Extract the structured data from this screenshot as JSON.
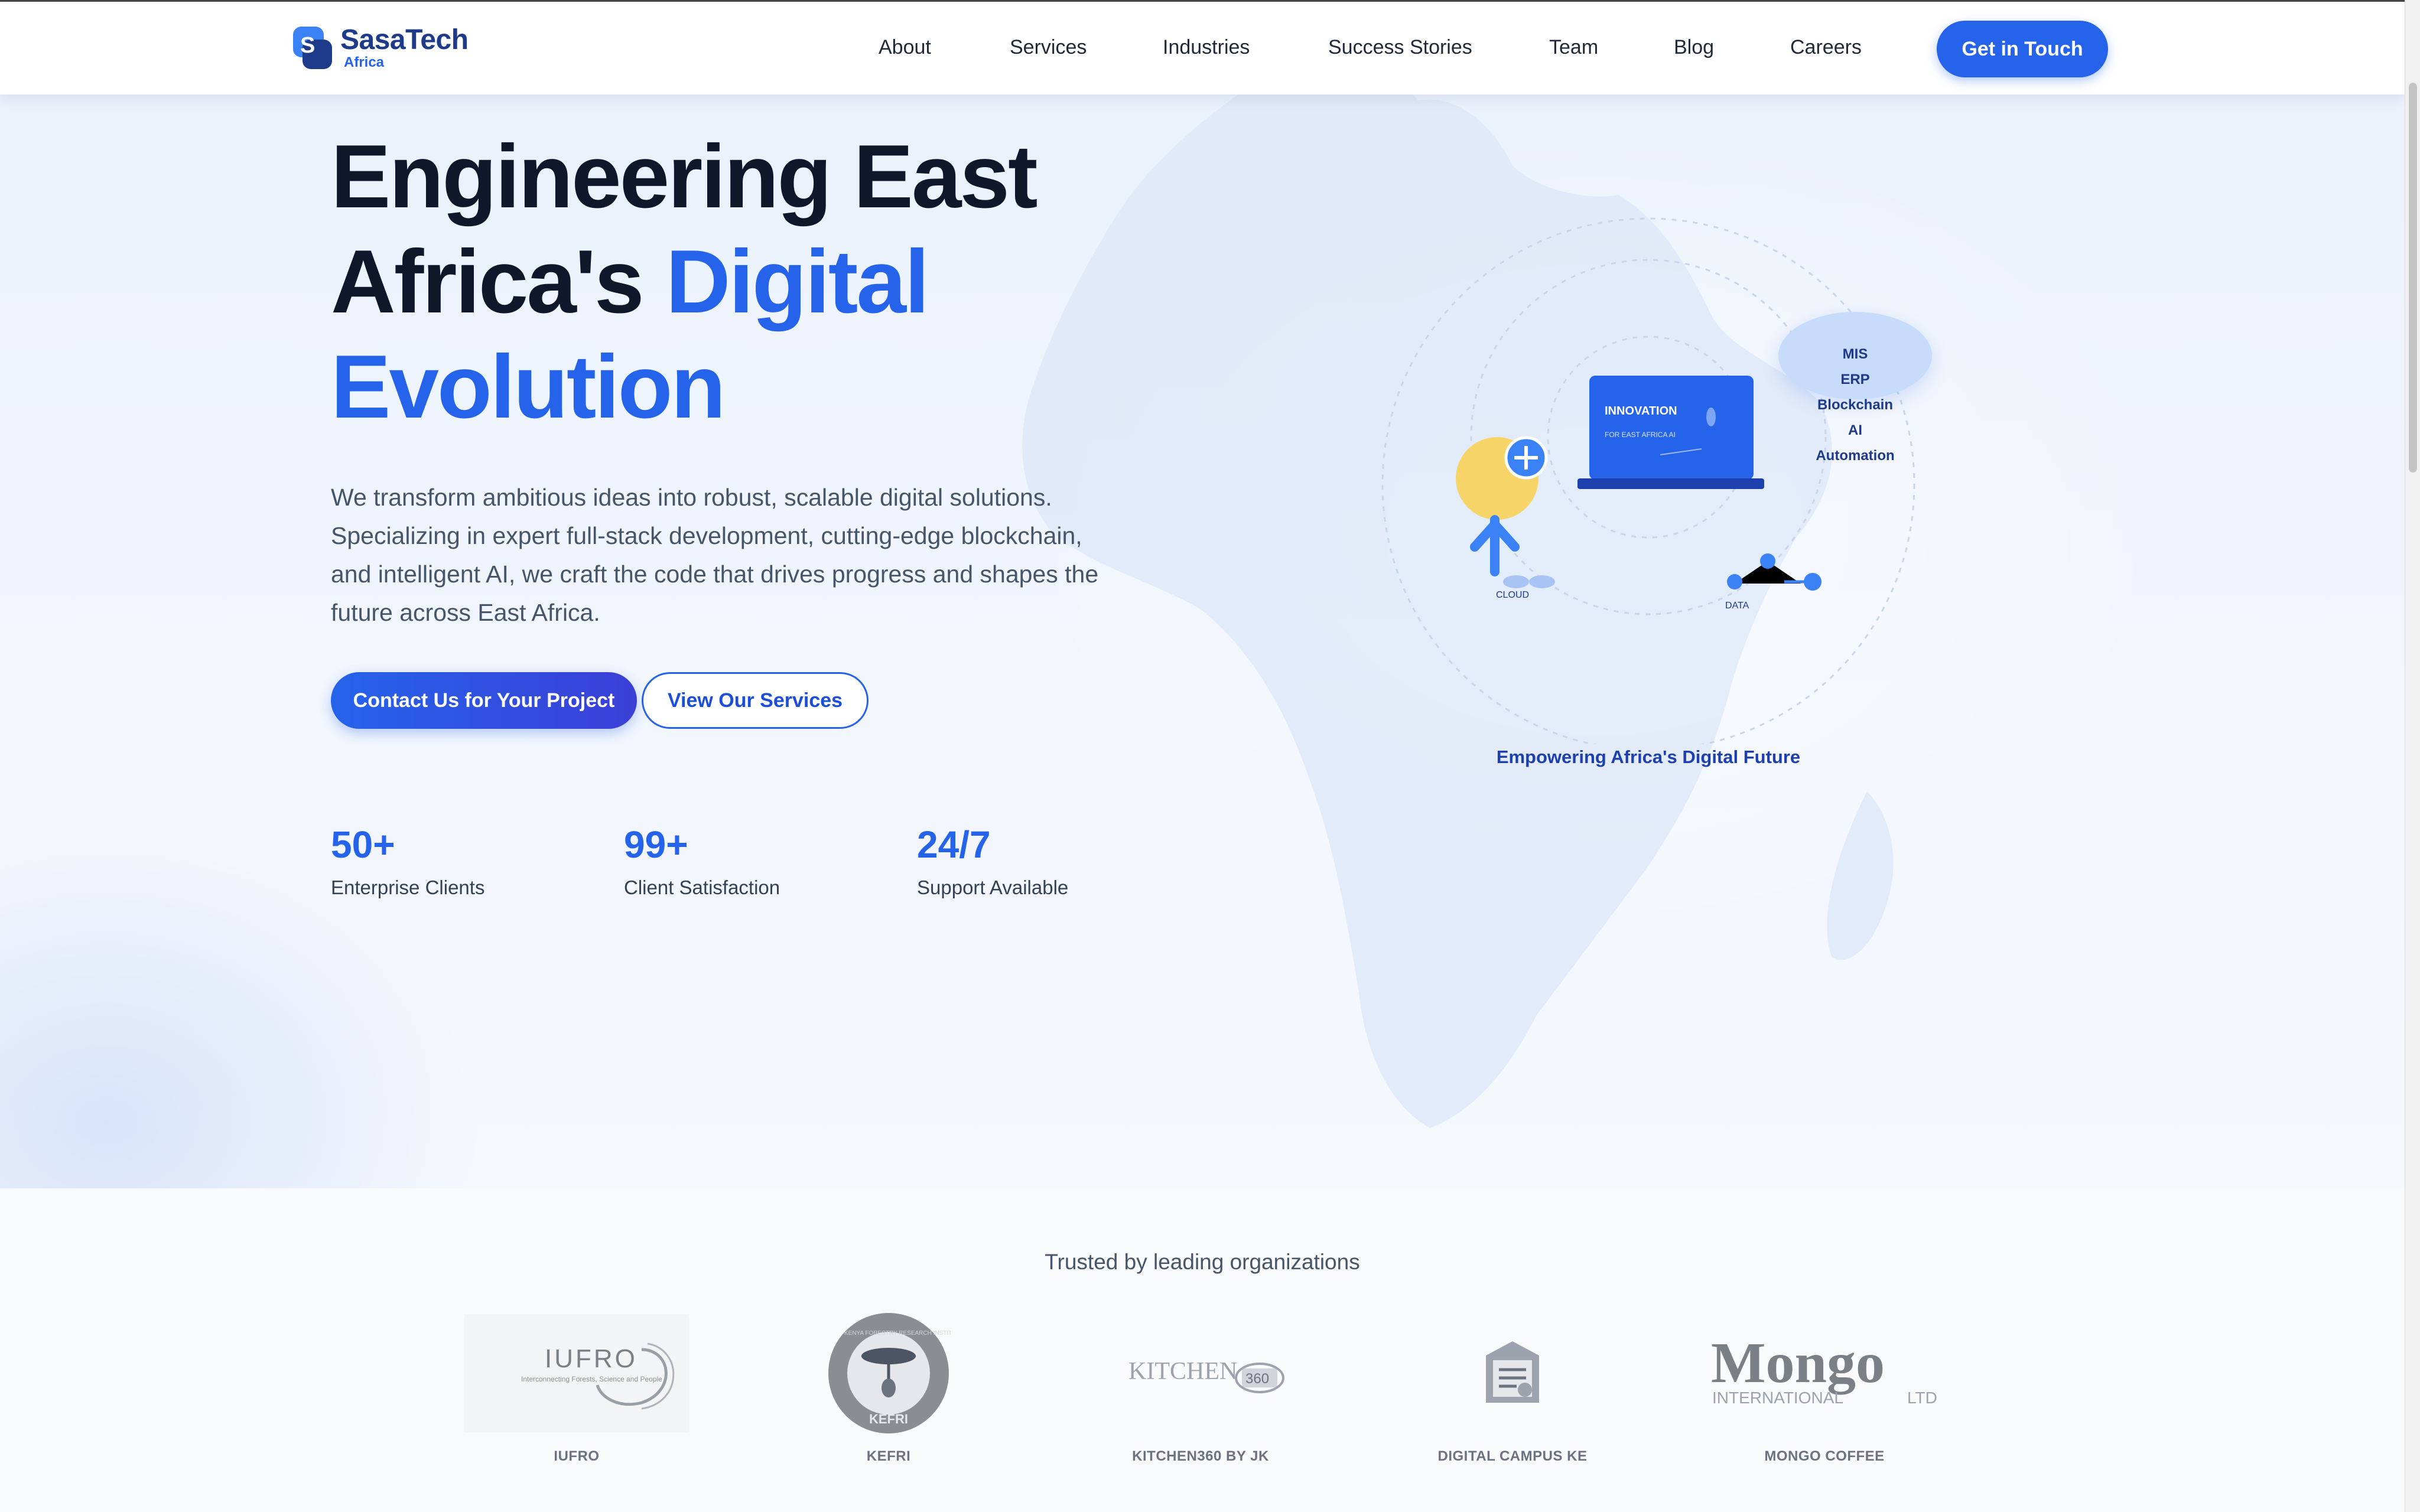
{
  "brand": {
    "name": "SasaTech",
    "sub": "Africa"
  },
  "nav": {
    "links": [
      "About",
      "Services",
      "Industries",
      "Success Stories",
      "Team",
      "Blog",
      "Careers"
    ],
    "cta": "Get in Touch"
  },
  "hero": {
    "title_line1": "Engineering East",
    "title_line2_plain": "Africa's ",
    "title_line2_accent": "Digital",
    "title_line3_accent": "Evolution",
    "description": "We transform ambitious ideas into robust, scalable digital solutions. Specializing in expert full-stack development, cutting-edge blockchain, and intelligent AI, we craft the code that drives progress and shapes the future across East Africa.",
    "primary_button": "Contact Us for Your Project",
    "secondary_button": "View Our Services",
    "stats": [
      {
        "value": "50+",
        "label": "Enterprise Clients"
      },
      {
        "value": "99+",
        "label": "Client Satisfaction"
      },
      {
        "value": "24/7",
        "label": "Support Available"
      }
    ]
  },
  "illustration": {
    "laptop_title": "INNOVATION",
    "laptop_subtitle": "FOR EAST AFRICA AI",
    "cloud_label": "CLOUD",
    "data_label": "DATA",
    "tech_list": [
      "MIS",
      "ERP",
      "Blockchain",
      "AI",
      "Automation"
    ],
    "caption": "Empowering Africa's Digital Future"
  },
  "trusted": {
    "title": "Trusted by leading organizations",
    "orgs": [
      {
        "name": "IUFRO",
        "logo_text": "IUFRO",
        "logo_tagline": "Interconnecting Forests, Science and People"
      },
      {
        "name": "KEFRI",
        "logo_text": "KEFRI",
        "logo_ring_text": "KENYA FORESTRY RESEARCH INSTITUTE"
      },
      {
        "name": "KITCHEN360 BY JK",
        "logo_text": "KITCHEN",
        "logo_badge": "360"
      },
      {
        "name": "DIGITAL CAMPUS KE"
      },
      {
        "name": "MONGO COFFEE",
        "logo_text": "Mongo",
        "logo_sub": "INTERNATIONAL",
        "logo_sub2": "LTD"
      }
    ]
  },
  "colors": {
    "primary": "#2563eb",
    "dark": "#0f172a",
    "navy": "#1e3a8a",
    "muted": "#475569"
  }
}
